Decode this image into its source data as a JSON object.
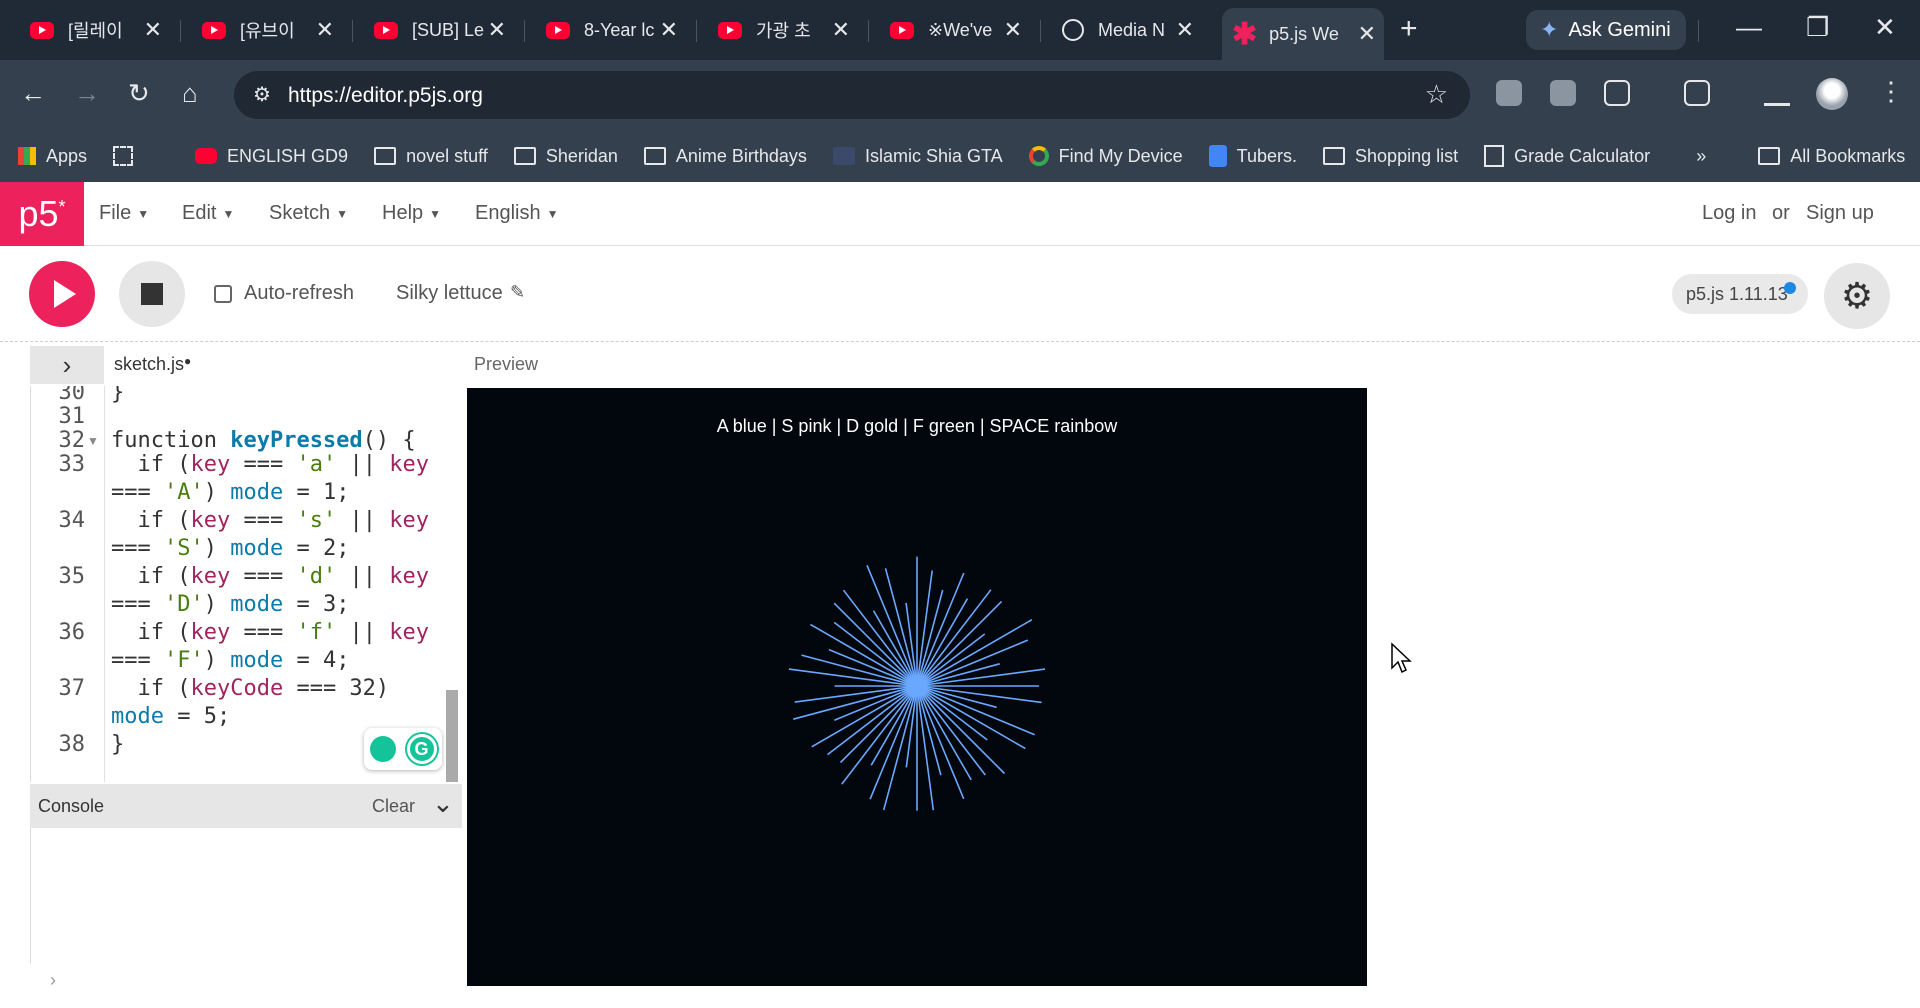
{
  "browser": {
    "tabs": [
      {
        "title": "[릴레이",
        "type": "youtube"
      },
      {
        "title": "[유브이",
        "type": "youtube"
      },
      {
        "title": "[SUB] Le",
        "type": "youtube"
      },
      {
        "title": "8-Year lc",
        "type": "youtube"
      },
      {
        "title": "가광 초",
        "type": "youtube"
      },
      {
        "title": "※We've",
        "type": "youtube"
      },
      {
        "title": "Media N",
        "type": "globe"
      },
      {
        "title": "p5.js We",
        "type": "p5",
        "active": true
      }
    ],
    "gemini_label": "Ask Gemini",
    "url": "https://editor.p5js.org",
    "bookmarks": [
      {
        "label": "Apps",
        "icon": "apps-grid-icon"
      },
      {
        "label": "ENGLISH GD9",
        "icon": "youtube-icon"
      },
      {
        "label": "novel stuff",
        "icon": "folder-icon"
      },
      {
        "label": "Sheridan",
        "icon": "folder-icon"
      },
      {
        "label": "Anime Birthdays",
        "icon": "folder-icon"
      },
      {
        "label": "Islamic Shia GTA",
        "icon": "site-icon"
      },
      {
        "label": "Find My Device",
        "icon": "find-device-icon"
      },
      {
        "label": "Tubers.",
        "icon": "doc-icon"
      },
      {
        "label": "Shopping list",
        "icon": "folder-icon"
      },
      {
        "label": "Grade Calculator",
        "icon": "calculator-icon"
      }
    ],
    "bookmarks_more": "»",
    "all_bookmarks": "All Bookmarks"
  },
  "p5": {
    "logo": "p5",
    "logo_sup": "*",
    "menus": [
      "File",
      "Edit",
      "Sketch",
      "Help",
      "English"
    ],
    "login": "Log in",
    "or": "or",
    "signup": "Sign up",
    "autorefresh": "Auto-refresh",
    "sketch_name": "Silky lettuce",
    "version": "p5.js 1.11.13",
    "file_name": "sketch.js",
    "file_modified": "●",
    "preview_label": "Preview",
    "console_label": "Console",
    "clear_label": "Clear"
  },
  "code": {
    "line_numbers": [
      "30",
      "31",
      "32",
      "33",
      "",
      "34",
      "",
      "35",
      "",
      "36",
      "",
      "37",
      "",
      "38"
    ],
    "lines": [
      "}",
      "",
      "function keyPressed() {",
      "  if (key === 'a' || key",
      "=== 'A') mode = 1;",
      "  if (key === 's' || key",
      "=== 'S') mode = 2;",
      "  if (key === 'd' || key",
      "=== 'D') mode = 3;",
      "  if (key === 'f' || key",
      "=== 'F') mode = 4;",
      "  if (keyCode === 32)",
      "mode = 5;",
      "}"
    ]
  },
  "canvas": {
    "hint_text": "A blue | S pink | D gold | F green | SPACE rainbow",
    "line_color": "#6aa8ff",
    "background": "#02060d"
  },
  "colors": {
    "p5_pink": "#ed225d",
    "chrome_dark": "#202a36",
    "chrome_mid": "#34404e"
  }
}
